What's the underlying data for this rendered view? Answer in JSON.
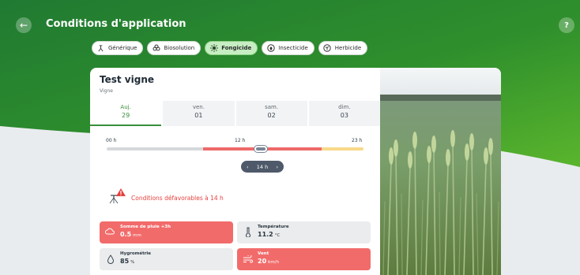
{
  "header": {
    "title": "Conditions d'application",
    "back_icon": "arrow-left-icon",
    "help_label": "?"
  },
  "categories": [
    {
      "label": "Générique",
      "icon": "sprayer-icon",
      "active": false
    },
    {
      "label": "Biosolution",
      "icon": "bio-icon",
      "active": false
    },
    {
      "label": "Fongicide",
      "icon": "fungus-icon",
      "active": true
    },
    {
      "label": "Insecticide",
      "icon": "insect-icon",
      "active": false
    },
    {
      "label": "Herbicide",
      "icon": "herb-icon",
      "active": false
    }
  ],
  "farm": {
    "name": "Test vigne",
    "crop": "Vigne"
  },
  "days": [
    {
      "name": "Auj.",
      "num": "29"
    },
    {
      "name": "ven.",
      "num": "01"
    },
    {
      "name": "sam.",
      "num": "02"
    },
    {
      "name": "dim.",
      "num": "03"
    }
  ],
  "timeline": {
    "start_label": "00 h",
    "mid_label": "12 h",
    "end_label": "23 h",
    "selected_label": "14 h",
    "prev_icon": "chevron-left-icon",
    "next_icon": "chevron-right-icon",
    "colors": {
      "grey": "#d5d9dc",
      "red": "#ee6a6a",
      "yellow": "#f8d98a"
    }
  },
  "warning": {
    "text": "Conditions défavorables à 14 h"
  },
  "metrics": [
    {
      "label": "Somme de pluie +3h",
      "value": "0.5",
      "unit": "mm",
      "state": "bad",
      "icon": "cloud-rain-icon"
    },
    {
      "label": "Température",
      "value": "11.2",
      "unit": "°C",
      "state": "ok",
      "icon": "thermometer-icon"
    },
    {
      "label": "Hygrométrie",
      "value": "85",
      "unit": "%",
      "state": "ok",
      "icon": "droplet-icon"
    },
    {
      "label": "Vent",
      "value": "20",
      "unit": "km/h",
      "state": "bad",
      "icon": "wind-icon"
    }
  ],
  "colors": {
    "brand_green": "#3a9a2e",
    "alert_red": "#f26b6b"
  }
}
